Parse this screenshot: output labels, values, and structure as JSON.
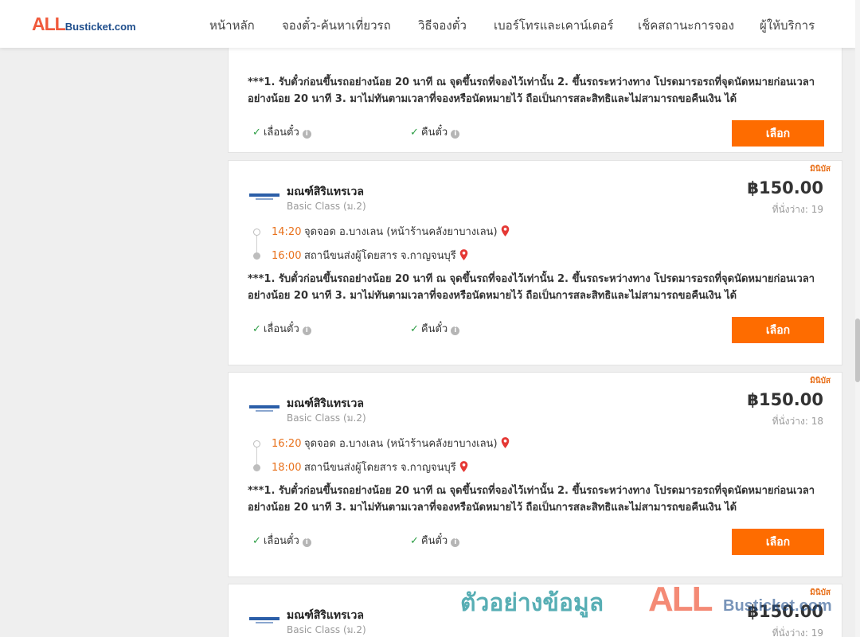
{
  "header": {
    "logo_all": "ALL",
    "logo_rest": "Busticket.com",
    "nav": [
      "หน้าหลัก",
      "จองตั๋ว-ค้นหาเที่ยวรถ",
      "วิธีจองตั๋ว",
      "เบอร์โทรและเคาน์เตอร์",
      "เช็คสถานะการจอง",
      "ผู้ให้บริการ"
    ]
  },
  "trips": [
    {
      "note": "***1. รับตั๋วก่อนขึ้นรถอย่างน้อย 20 นาที ณ จุดขึ้นรถที่จองไว้เท่านั้น 2. ขึ้นรถระหว่างทาง โปรดมารอรถที่จุดนัดหมายก่อนเวลาอย่างน้อย 20 นาที 3. มาไม่ทันตามเวลาที่จองหรือนัดหมายไว้ ถือเป็นการสละสิทธิและไม่สามารถขอคืนเงิน ได้",
      "change_label": "เลื่อนตั๋ว",
      "refund_label": "คืนตั๋ว",
      "button_label": "เลือก"
    },
    {
      "badge": "มินิบัส",
      "operator": "มณฑ์สิริแทรเวล",
      "vehicle_class": "Basic Class (ม.2)",
      "price": "฿150.00",
      "seats": "ที่นั่งว่าง: 19",
      "depart_time": "14:20",
      "depart_place": "จุดจอด อ.บางเลน (หน้าร้านคลังยาบางเลน)",
      "arrive_time": "16:00",
      "arrive_place": "สถานีขนส่งผู้โดยสาร จ.กาญจนบุรี",
      "note": "***1. รับตั๋วก่อนขึ้นรถอย่างน้อย 20 นาที ณ จุดขึ้นรถที่จองไว้เท่านั้น 2. ขึ้นรถระหว่างทาง โปรดมารอรถที่จุดนัดหมายก่อนเวลาอย่างน้อย 20 นาที 3. มาไม่ทันตามเวลาที่จองหรือนัดหมายไว้ ถือเป็นการสละสิทธิและไม่สามารถขอคืนเงิน ได้",
      "change_label": "เลื่อนตั๋ว",
      "refund_label": "คืนตั๋ว",
      "button_label": "เลือก"
    },
    {
      "badge": "มินิบัส",
      "operator": "มณฑ์สิริแทรเวล",
      "vehicle_class": "Basic Class (ม.2)",
      "price": "฿150.00",
      "seats": "ที่นั่งว่าง: 18",
      "depart_time": "16:20",
      "depart_place": "จุดจอด อ.บางเลน (หน้าร้านคลังยาบางเลน)",
      "arrive_time": "18:00",
      "arrive_place": "สถานีขนส่งผู้โดยสาร จ.กาญจนบุรี",
      "note": "***1. รับตั๋วก่อนขึ้นรถอย่างน้อย 20 นาที ณ จุดขึ้นรถที่จองไว้เท่านั้น 2. ขึ้นรถระหว่างทาง โปรดมารอรถที่จุดนัดหมายก่อนเวลาอย่างน้อย 20 นาที 3. มาไม่ทันตามเวลาที่จองหรือนัดหมายไว้ ถือเป็นการสละสิทธิและไม่สามารถขอคืนเงิน ได้",
      "change_label": "เลื่อนตั๋ว",
      "refund_label": "คืนตั๋ว",
      "button_label": "เลือก"
    },
    {
      "badge": "มินิบัส",
      "operator": "มณฑ์สิริแทรเวล",
      "vehicle_class": "Basic Class (ม.2)",
      "price": "฿150.00",
      "seats": "ที่นั่งว่าง: 19"
    }
  ],
  "watermark": {
    "text": "ตัวอย่างข้อมูล",
    "logo_all": "ALL",
    "logo_rest": "Busticket.com"
  },
  "colors": {
    "accent_orange": "#fe6c00",
    "time_orange": "#e8711c",
    "check_green": "#2e9e46",
    "pin_red": "#e53935"
  }
}
